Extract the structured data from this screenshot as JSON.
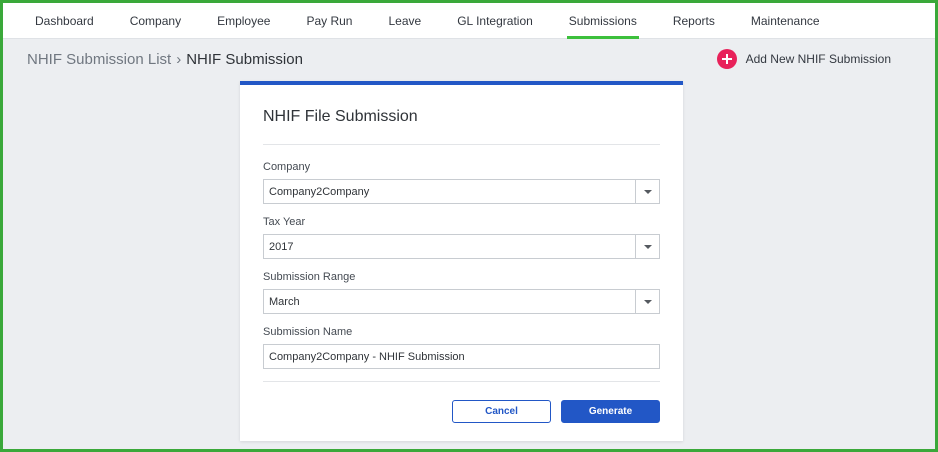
{
  "nav": {
    "items": [
      {
        "label": "Dashboard",
        "active": false
      },
      {
        "label": "Company",
        "active": false
      },
      {
        "label": "Employee",
        "active": false
      },
      {
        "label": "Pay Run",
        "active": false
      },
      {
        "label": "Leave",
        "active": false
      },
      {
        "label": "GL Integration",
        "active": false
      },
      {
        "label": "Submissions",
        "active": true
      },
      {
        "label": "Reports",
        "active": false
      },
      {
        "label": "Maintenance",
        "active": false
      }
    ]
  },
  "breadcrumb": {
    "parent": "NHIF Submission List",
    "separator": "›",
    "current": "NHIF Submission"
  },
  "header_action": {
    "add_label": "Add New NHIF Submission",
    "icon": "plus-circle-icon"
  },
  "form": {
    "title": "NHIF File Submission",
    "company": {
      "label": "Company",
      "value": "Company2Company"
    },
    "tax_year": {
      "label": "Tax Year",
      "value": "2017"
    },
    "submission_range": {
      "label": "Submission Range",
      "value": "March"
    },
    "submission_name": {
      "label": "Submission Name",
      "value": "Company2Company - NHIF Submission"
    },
    "cancel_label": "Cancel",
    "generate_label": "Generate"
  },
  "colors": {
    "frame_border": "#3aa83a",
    "active_tab": "#3cc03c",
    "primary": "#2257c6",
    "add_button": "#e8215a",
    "background": "#eceef1"
  }
}
